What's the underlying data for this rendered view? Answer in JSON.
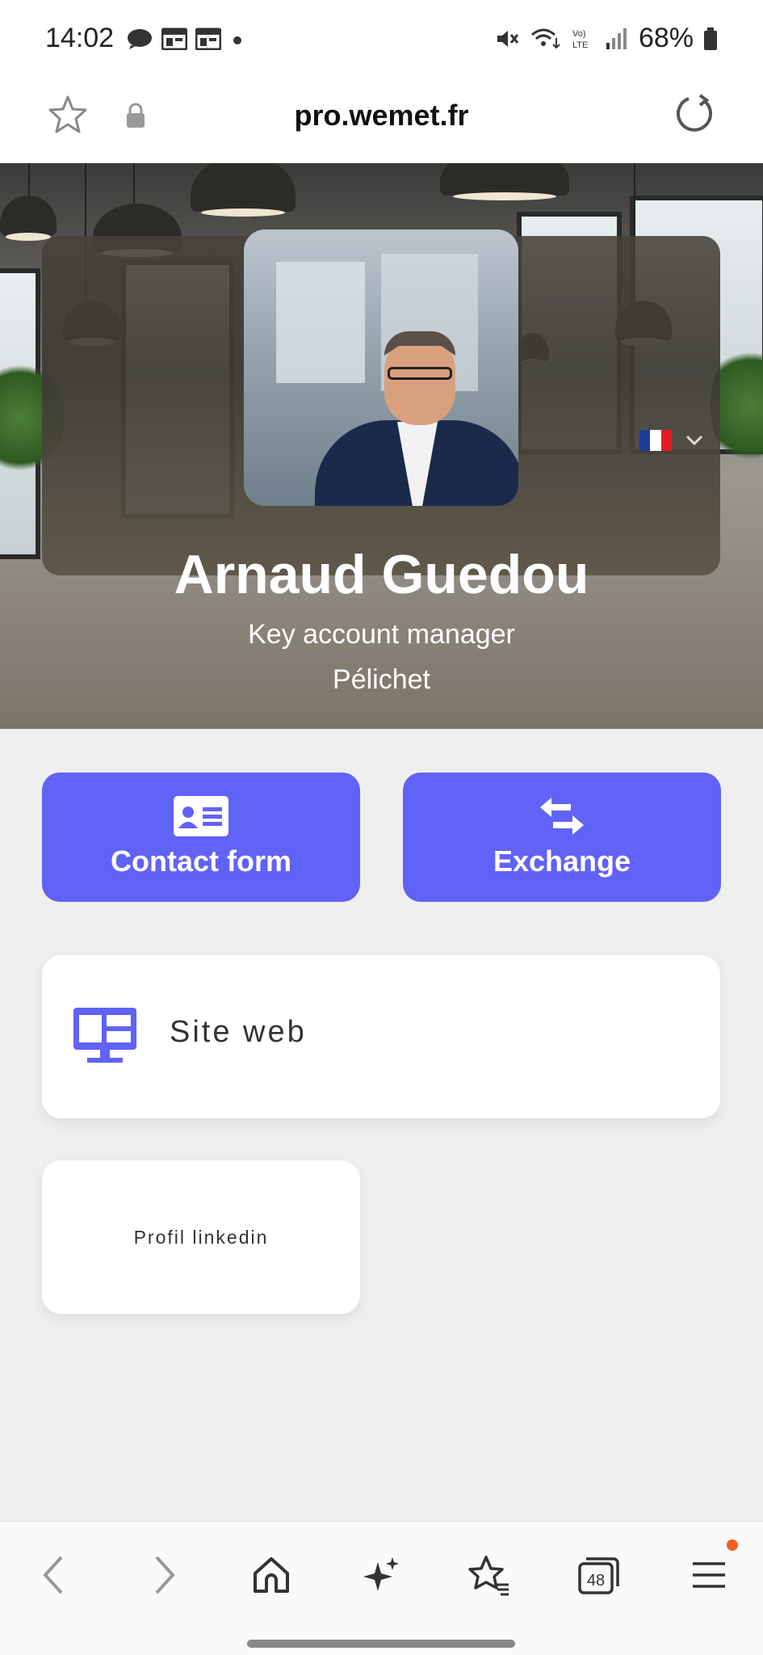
{
  "status_bar": {
    "time": "14:02",
    "battery": "68%",
    "icons": [
      "chat-icon",
      "calendar-icon",
      "calendar-icon",
      "dot-icon",
      "mute-icon",
      "wifi-icon",
      "volte-icon",
      "signal-icon",
      "battery-icon"
    ]
  },
  "address_bar": {
    "url": "pro.wemet.fr"
  },
  "profile": {
    "name": "Arnaud Guedou",
    "job_title": "Key account manager",
    "company": "Pélichet",
    "language_flag_colors": [
      "#1e3c9a",
      "#ffffff",
      "#e11b22"
    ]
  },
  "actions": {
    "contact_form_label": "Contact form",
    "exchange_label": "Exchange"
  },
  "links": {
    "site_web_label": "Site web",
    "linkedin_label": "Profil linkedin"
  },
  "bottom_nav": {
    "tabs_count": "48"
  },
  "colors": {
    "accent": "#6162f6",
    "notification_dot": "#f0621d"
  }
}
